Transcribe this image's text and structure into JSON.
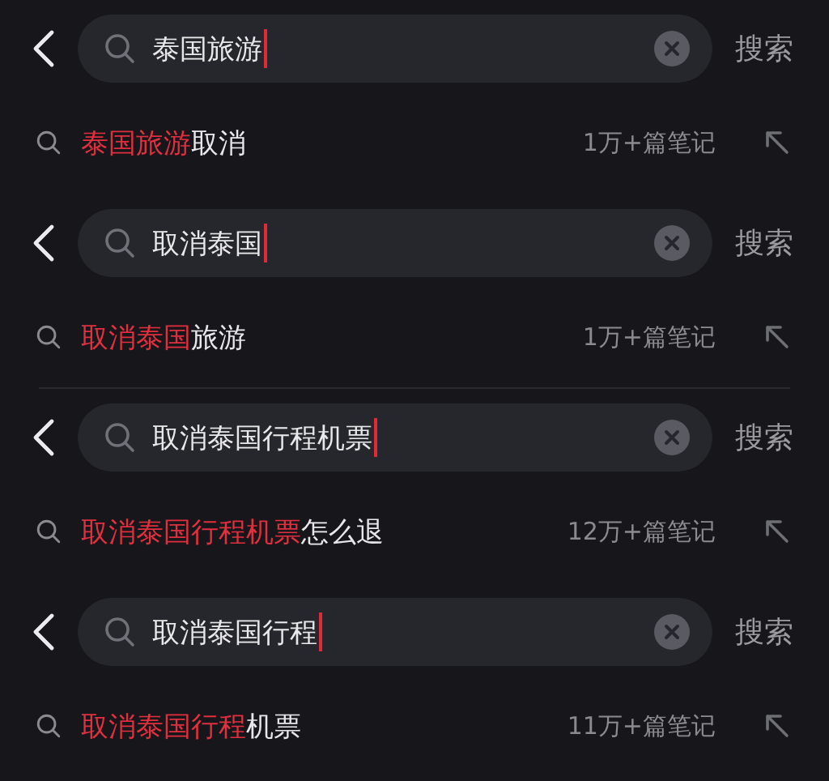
{
  "blocks": [
    {
      "query": "泰国旅游",
      "action": "搜索",
      "suggestion": {
        "match": "泰国旅游",
        "rest": "取消",
        "count": "1万+篇笔记"
      },
      "divider": false
    },
    {
      "query": "取消泰国",
      "action": "搜索",
      "suggestion": {
        "match": "取消泰国",
        "rest": "旅游",
        "count": "1万+篇笔记"
      },
      "divider": true
    },
    {
      "query": "取消泰国行程机票",
      "action": "搜索",
      "suggestion": {
        "match": "取消泰国行程机票",
        "rest": "怎么退",
        "count": "12万+篇笔记"
      },
      "divider": false
    },
    {
      "query": "取消泰国行程",
      "action": "搜索",
      "suggestion": {
        "match": "取消泰国行程",
        "rest": "机票",
        "count": "11万+篇笔记"
      },
      "divider": false
    }
  ]
}
